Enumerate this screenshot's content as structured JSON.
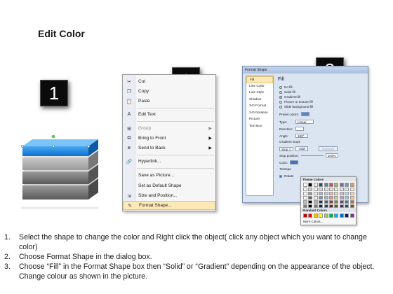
{
  "title": "Edit Color",
  "badges": [
    "1",
    "2",
    "3"
  ],
  "context_menu": {
    "items": [
      {
        "label": "Cut",
        "icon": "scissors-icon",
        "glyph": "✂"
      },
      {
        "label": "Copy",
        "icon": "copy-icon",
        "glyph": "❐"
      },
      {
        "label": "Paste",
        "icon": "paste-icon",
        "glyph": "📋"
      },
      {
        "label": "Edit Text",
        "icon": "text-icon",
        "glyph": "A"
      },
      {
        "label": "Group",
        "icon": "group-icon",
        "glyph": "⊞",
        "submenu": true
      },
      {
        "label": "Bring to Front",
        "icon": "bring-front-icon",
        "glyph": "⧉",
        "submenu": true
      },
      {
        "label": "Send to Back",
        "icon": "send-back-icon",
        "glyph": "⧈",
        "submenu": true
      },
      {
        "label": "Hyperlink...",
        "icon": "hyperlink-icon",
        "glyph": "🔗"
      },
      {
        "label": "Save as Picture...",
        "icon": "",
        "glyph": ""
      },
      {
        "label": "Set as Default Shape",
        "icon": "",
        "glyph": ""
      },
      {
        "label": "Size and Position...",
        "icon": "size-icon",
        "glyph": "⇲"
      },
      {
        "label": "Format Shape...",
        "icon": "format-shape-icon",
        "glyph": "✎"
      }
    ]
  },
  "dialog": {
    "title": "Format Shape",
    "sidebar": [
      "Fill",
      "Line Color",
      "Line Style",
      "Shadow",
      "3-D Format",
      "3-D Rotation",
      "Picture",
      "Text Box"
    ],
    "pane_heading": "Fill",
    "fill_options": [
      "No fill",
      "Solid fill",
      "Gradient fill",
      "Picture or texture fill",
      "Slide background fill"
    ],
    "preset_label": "Preset colors:",
    "type_label": "Type:",
    "type_value": "Linear",
    "direction_label": "Direction:",
    "angle_label": "Angle:",
    "angle_value": "180°",
    "gradient_stops_label": "Gradient stops",
    "stop_value": "Stop 1",
    "add_label": "Add",
    "remove_label": "Remove",
    "stop_position_label": "Stop position:",
    "stop_position_value": "100%",
    "color_label": "Color:",
    "transparency_label": "Transpa",
    "rotate_label": "Rotate",
    "close_label": "Close"
  },
  "picker": {
    "theme_label": "Theme Colors",
    "standard_label": "Standard Colors",
    "more_label": "More Colors...",
    "theme_top": [
      "#ffffff",
      "#000000",
      "#eeece1",
      "#1f497d",
      "#4f81bd",
      "#c0504d",
      "#9bbb59",
      "#8064a2",
      "#4bacc6",
      "#f79646"
    ],
    "standard": [
      "#c00000",
      "#ff0000",
      "#ffc000",
      "#ffff00",
      "#92d050",
      "#00b050",
      "#00b0f0",
      "#0070c0",
      "#002060",
      "#7030a0"
    ]
  },
  "steps": [
    {
      "num": "1.",
      "text": "Select the shape to change the color and Right click the object( click any object which you want to change color)"
    },
    {
      "num": "2.",
      "text": "Choose Format Shape in the dialog box."
    },
    {
      "num": "3.",
      "text": "Choose “Fill” in the Format Shape box then “Solid” or “Gradient” depending on the appearance of the object. Change colour as shown in the picture."
    }
  ]
}
